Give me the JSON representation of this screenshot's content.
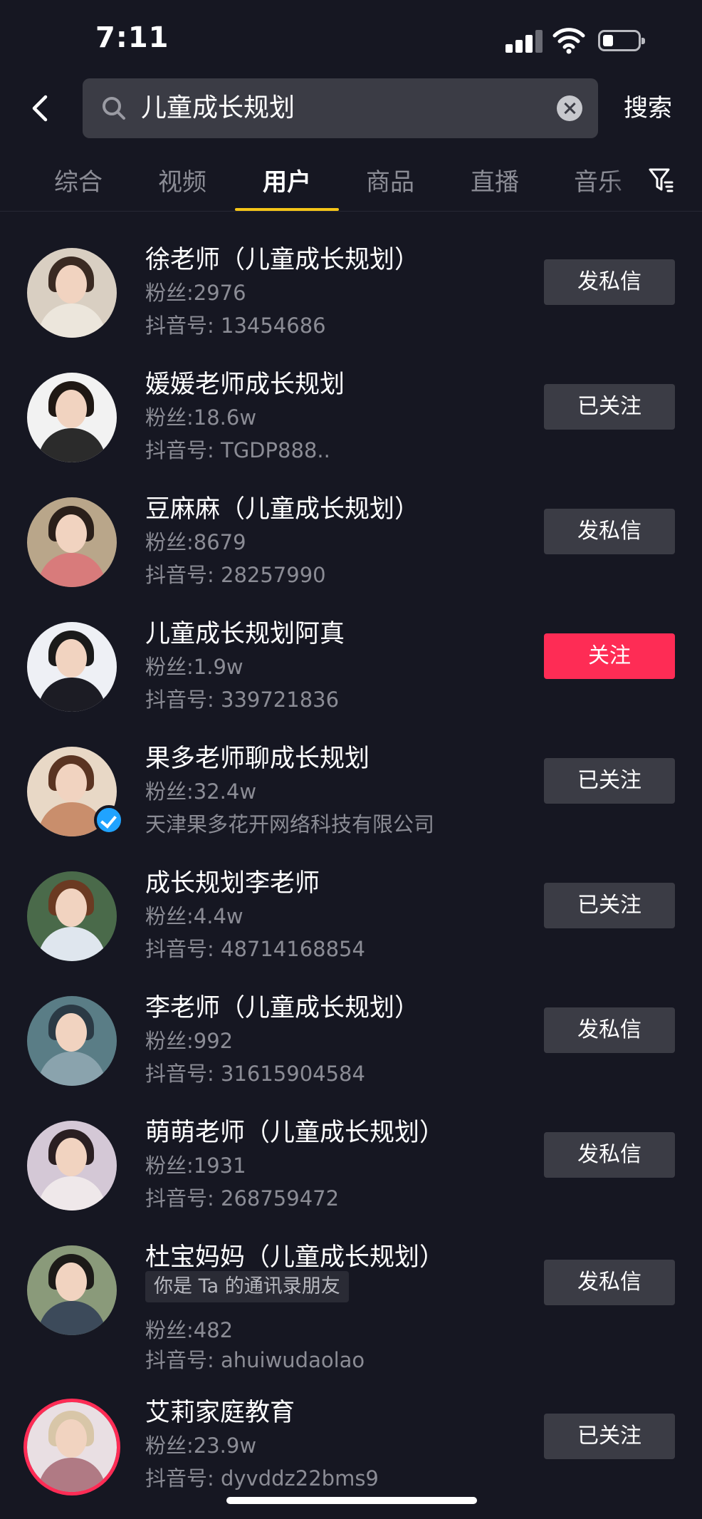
{
  "status_bar": {
    "time": "7:11"
  },
  "search": {
    "query": "儿童成长规划",
    "button_label": "搜索"
  },
  "tabs": [
    {
      "label": "综合",
      "active": false
    },
    {
      "label": "视频",
      "active": false
    },
    {
      "label": "用户",
      "active": true
    },
    {
      "label": "商品",
      "active": false
    },
    {
      "label": "直播",
      "active": false
    },
    {
      "label": "音乐",
      "active": false
    }
  ],
  "users": [
    {
      "name": "徐老师（儿童成长规划）",
      "fans": "粉丝:2976",
      "sub": "抖音号: 13454686",
      "action": "发私信",
      "action_type": "message"
    },
    {
      "name": "媛媛老师成长规划",
      "fans": "粉丝:18.6w",
      "sub": "抖音号: TGDP888..",
      "action": "已关注",
      "action_type": "followed"
    },
    {
      "name": "豆麻麻（儿童成长规划）",
      "fans": "粉丝:8679",
      "sub": "抖音号: 28257990",
      "action": "发私信",
      "action_type": "message"
    },
    {
      "name": "儿童成长规划阿真",
      "fans": "粉丝:1.9w",
      "sub": "抖音号: 339721836",
      "action": "关注",
      "action_type": "follow"
    },
    {
      "name": "果多老师聊成长规划",
      "fans": "粉丝:32.4w",
      "sub": "天津果多花开网络科技有限公司",
      "action": "已关注",
      "action_type": "followed",
      "verified": true
    },
    {
      "name": "成长规划李老师",
      "fans": "粉丝:4.4w",
      "sub": "抖音号: 48714168854",
      "action": "已关注",
      "action_type": "followed"
    },
    {
      "name": "李老师（儿童成长规划）",
      "fans": "粉丝:992",
      "sub": "抖音号: 31615904584",
      "action": "发私信",
      "action_type": "message"
    },
    {
      "name": "萌萌老师（儿童成长规划）",
      "fans": "粉丝:1931",
      "sub": "抖音号: 268759472",
      "action": "发私信",
      "action_type": "message"
    },
    {
      "name": "杜宝妈妈（儿童成长规划）",
      "tag": "你是 Ta 的通讯录朋友",
      "fans": "粉丝:482",
      "sub": "抖音号: ahuiwudaolao",
      "action": "发私信",
      "action_type": "message"
    },
    {
      "name": "艾莉家庭教育",
      "fans": "粉丝:23.9w",
      "sub": "抖音号: dyvddz22bms9",
      "action": "已关注",
      "action_type": "followed",
      "live": true
    }
  ],
  "colors": {
    "background": "#161722",
    "accent_follow": "#fe2c55",
    "tab_indicator": "#f5c518",
    "verified": "#20a3ff"
  }
}
